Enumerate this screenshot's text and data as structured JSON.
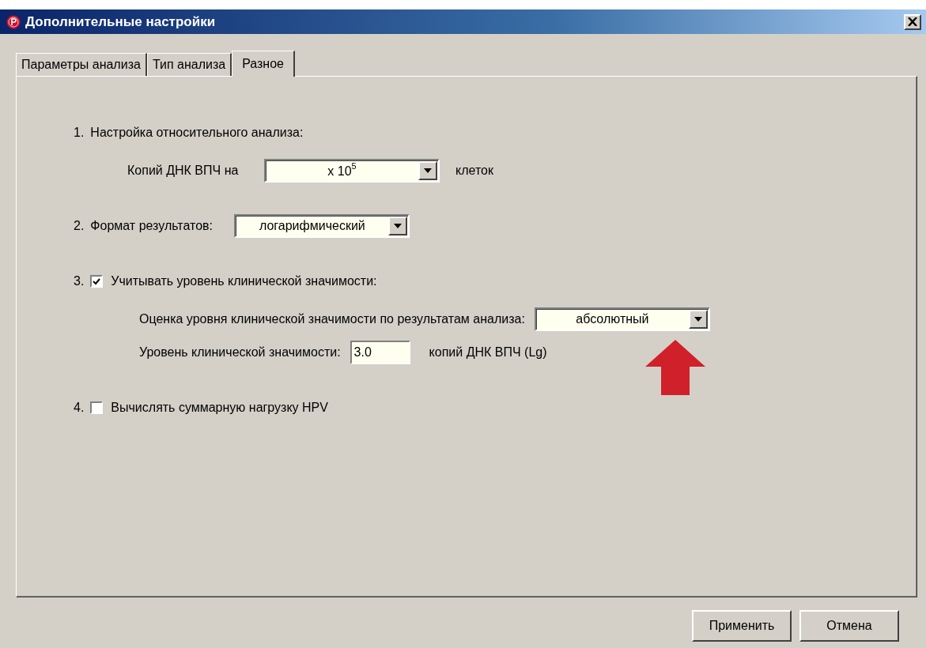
{
  "window": {
    "title": "Дополнительные настройки"
  },
  "tabs": [
    {
      "label": "Параметры анализа",
      "selected": false
    },
    {
      "label": "Тип анализа",
      "selected": false
    },
    {
      "label": "Разное",
      "selected": true
    }
  ],
  "settings": [
    {
      "kind": "heading",
      "number": "1.",
      "label": "Настройка относительного анализа:",
      "children": [
        {
          "kind": "combo",
          "label": "Копий ДНК ВПЧ на",
          "value": "x 10$^{5}$",
          "suffix": "клеток"
        }
      ]
    },
    {
      "kind": "combo",
      "number": "2.",
      "label": "Формат результатов:",
      "value": "логарифмический"
    },
    {
      "kind": "checkbox",
      "number": "3.",
      "label": "Учитывать уровень клинической значимости:",
      "checked": true,
      "children": [
        {
          "kind": "combo",
          "label": "Оценка уровня клинической значимости по результатам анализа:",
          "value": "абсолютный"
        },
        {
          "kind": "input",
          "label": "Уровень клинической значимости:",
          "value": "3.0",
          "suffix": "копий ДНК ВПЧ (Lg)"
        }
      ]
    },
    {
      "kind": "checkbox",
      "number": "4.",
      "label": "Вычислять суммарную нагрузку HPV",
      "checked": false
    }
  ],
  "buttons": [
    "Применить",
    "Отмена"
  ]
}
